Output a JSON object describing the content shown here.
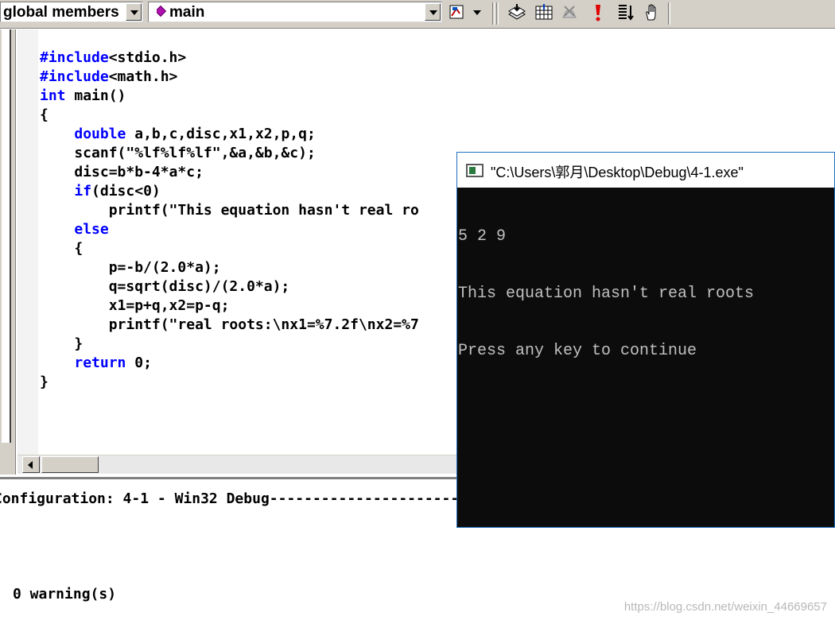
{
  "toolbar": {
    "members_combo": "global members",
    "function_combo": "main",
    "icons": [
      "wizard-bar-icon",
      "compile-icon",
      "build-icon",
      "stop-build-icon",
      "execute-icon",
      "go-icon",
      "insert-breakpoint-icon"
    ]
  },
  "editor": {
    "code_lines": [
      "#include<stdio.h>",
      "#include<math.h>",
      "int main()",
      "{",
      "    double a,b,c,disc,x1,x2,p,q;",
      "    scanf(\"%lf%lf%lf\",&a,&b,&c);",
      "    disc=b*b-4*a*c;",
      "    if(disc<0)",
      "        printf(\"This equation hasn't real ro",
      "    else",
      "    {",
      "        p=-b/(2.0*a);",
      "        q=sqrt(disc)/(2.0*a);",
      "        x1=p+q,x2=p-q;",
      "        printf(\"real roots:\\nx1=%7.2f\\nx2=%7",
      "    }",
      "    return 0;",
      "}"
    ]
  },
  "output": {
    "config_line": "Configuration: 4-1 - Win32 Debug-----------------------------",
    "warning_line": "0 warning(s)"
  },
  "console": {
    "title": "\"C:\\Users\\郭月\\Desktop\\Debug\\4-1.exe\"",
    "lines": [
      "5 2 9",
      "This equation hasn't real roots",
      "Press any key to continue"
    ]
  },
  "watermark": "https://blog.csdn.net/weixin_44669657"
}
